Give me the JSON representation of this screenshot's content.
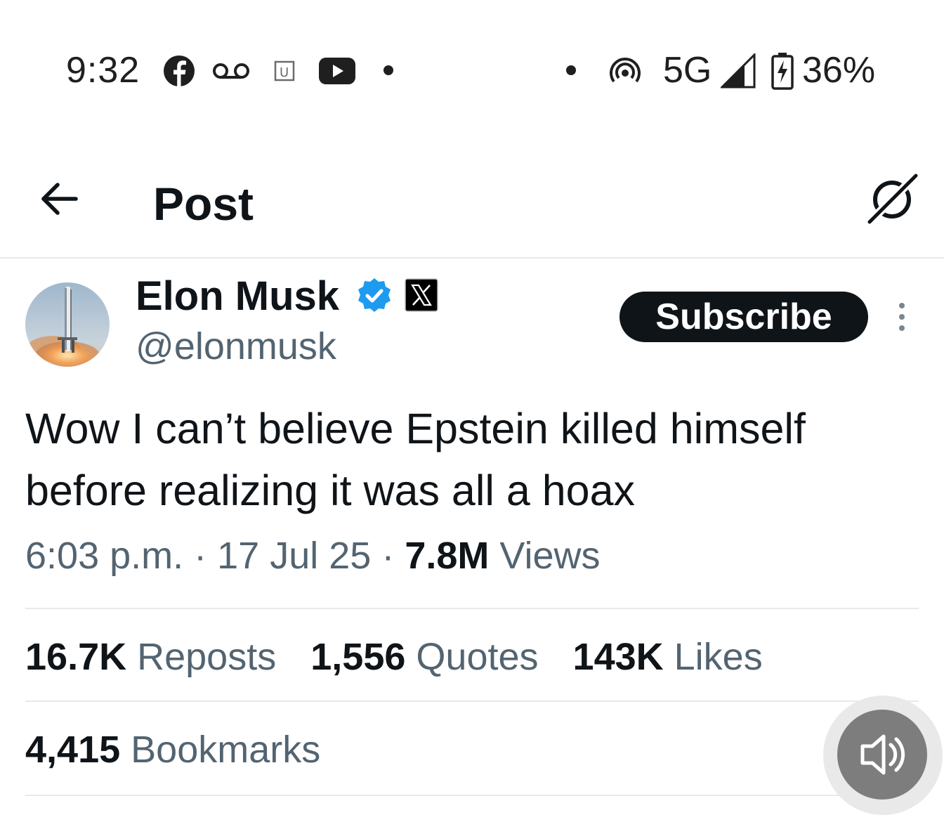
{
  "status_bar": {
    "time": "9:32",
    "network": "5G",
    "battery": "36%",
    "icons": [
      "facebook-icon",
      "voicemail-icon",
      "app-u-icon",
      "youtube-icon",
      "notification-dot-icon",
      "dot-icon",
      "hotspot-icon",
      "signal-icon",
      "battery-charging-icon"
    ]
  },
  "header": {
    "title": "Post",
    "back_icon": "back-arrow-icon",
    "right_icon": "grok-icon"
  },
  "post": {
    "author_name": "Elon Musk",
    "handle": "@elonmusk",
    "verified_icon": "verified-badge-icon",
    "affiliate_icon": "x-logo-icon",
    "subscribe_label": "Subscribe",
    "text": "Wow I can’t believe Epstein killed himself before realizing it was all a hoax",
    "time": "6:03 p.m.",
    "date": "17 Jul 25",
    "views_count": "7.8M",
    "views_label": "Views",
    "separator": "·"
  },
  "stats": {
    "reposts_count": "16.7K",
    "reposts_label": "Reposts",
    "quotes_count": "1,556",
    "quotes_label": "Quotes",
    "likes_count": "143K",
    "likes_label": "Likes",
    "bookmarks_count": "4,415",
    "bookmarks_label": "Bookmarks"
  },
  "colors": {
    "text_primary": "#0f1419",
    "text_secondary": "#536471",
    "verified": "#1d9bf0",
    "divider": "#e6e9eb"
  }
}
